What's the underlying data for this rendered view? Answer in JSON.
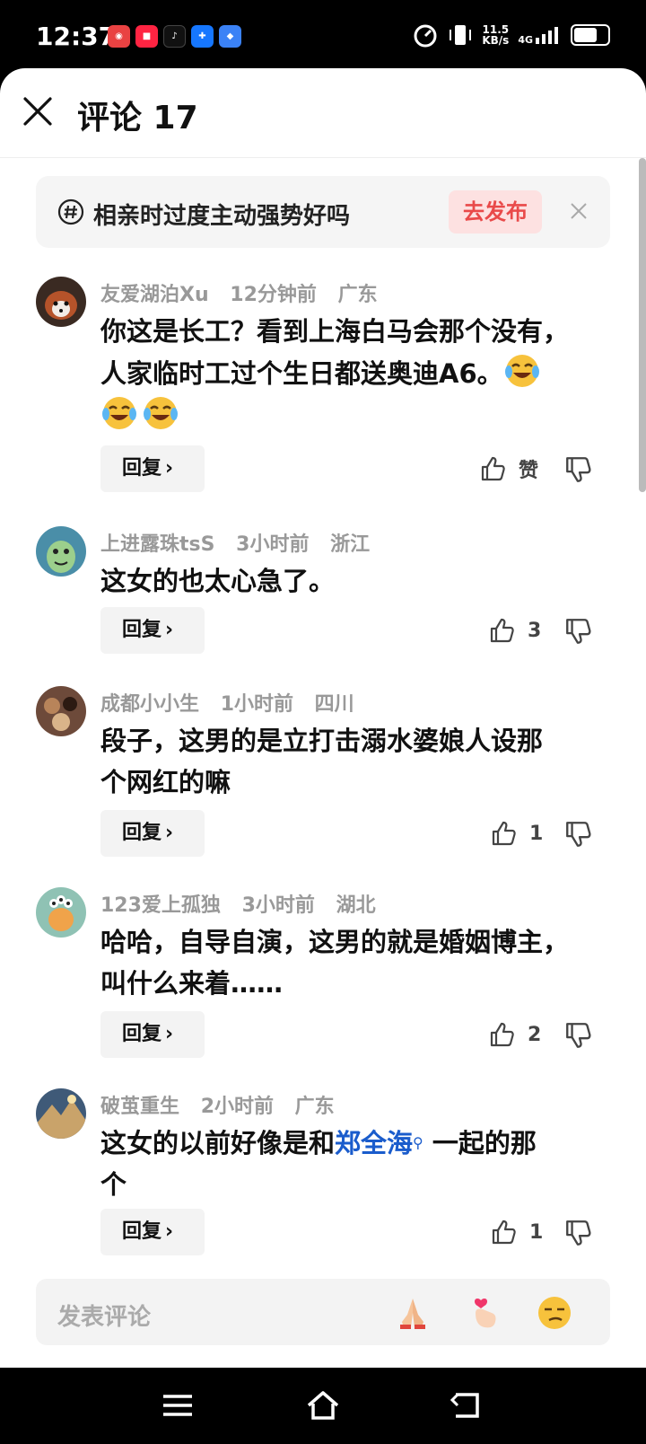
{
  "status": {
    "time": "12:37",
    "speed_value": "11.5",
    "speed_unit": "KB/s",
    "network": "4G",
    "battery_level": 0.62,
    "app_icons": [
      "youku-icon",
      "xiaohongshu-icon",
      "tiktok-icon",
      "alipay-icon",
      "app-icon"
    ]
  },
  "header": {
    "title": "评论 17"
  },
  "topic": {
    "text": "相亲时过度主动强势好吗",
    "publish": "去发布"
  },
  "comments": [
    {
      "user": "友爱湖泊Xu",
      "time": "12分钟前",
      "region": "广东",
      "text_line1": "你这是长工？看到上海白马会那个没有，",
      "text_line2": "人家临时工过个生日都送奥迪A6。",
      "reply": "回复",
      "likes": "赞"
    },
    {
      "user": "上进露珠tsS",
      "time": "3小时前",
      "region": "浙江",
      "text": "这女的也太心急了。",
      "reply": "回复",
      "likes": "3"
    },
    {
      "user": "成都小小生",
      "time": "1小时前",
      "region": "四川",
      "text_line1": "段子，这男的是立打击溺水婆娘人设那",
      "text_line2": "个网红的嘛",
      "reply": "回复",
      "likes": "1"
    },
    {
      "user": "123爱上孤独",
      "time": "3小时前",
      "region": "湖北",
      "text_line1": "哈哈，自导自演，这男的就是婚姻博主，",
      "text_line2": "叫什么来着……",
      "reply": "回复",
      "likes": "2"
    },
    {
      "user": "破茧重生",
      "time": "2小时前",
      "region": "广东",
      "text_pre": "这女的以前好像是和",
      "text_link": "郑全海",
      "text_post": " 一起的那",
      "text_line2": "个",
      "reply": "回复",
      "likes": "1"
    }
  ],
  "input": {
    "placeholder": "发表评论"
  },
  "colors": {
    "accent_red": "#e94a4a",
    "link_blue": "#1a5ccc"
  }
}
